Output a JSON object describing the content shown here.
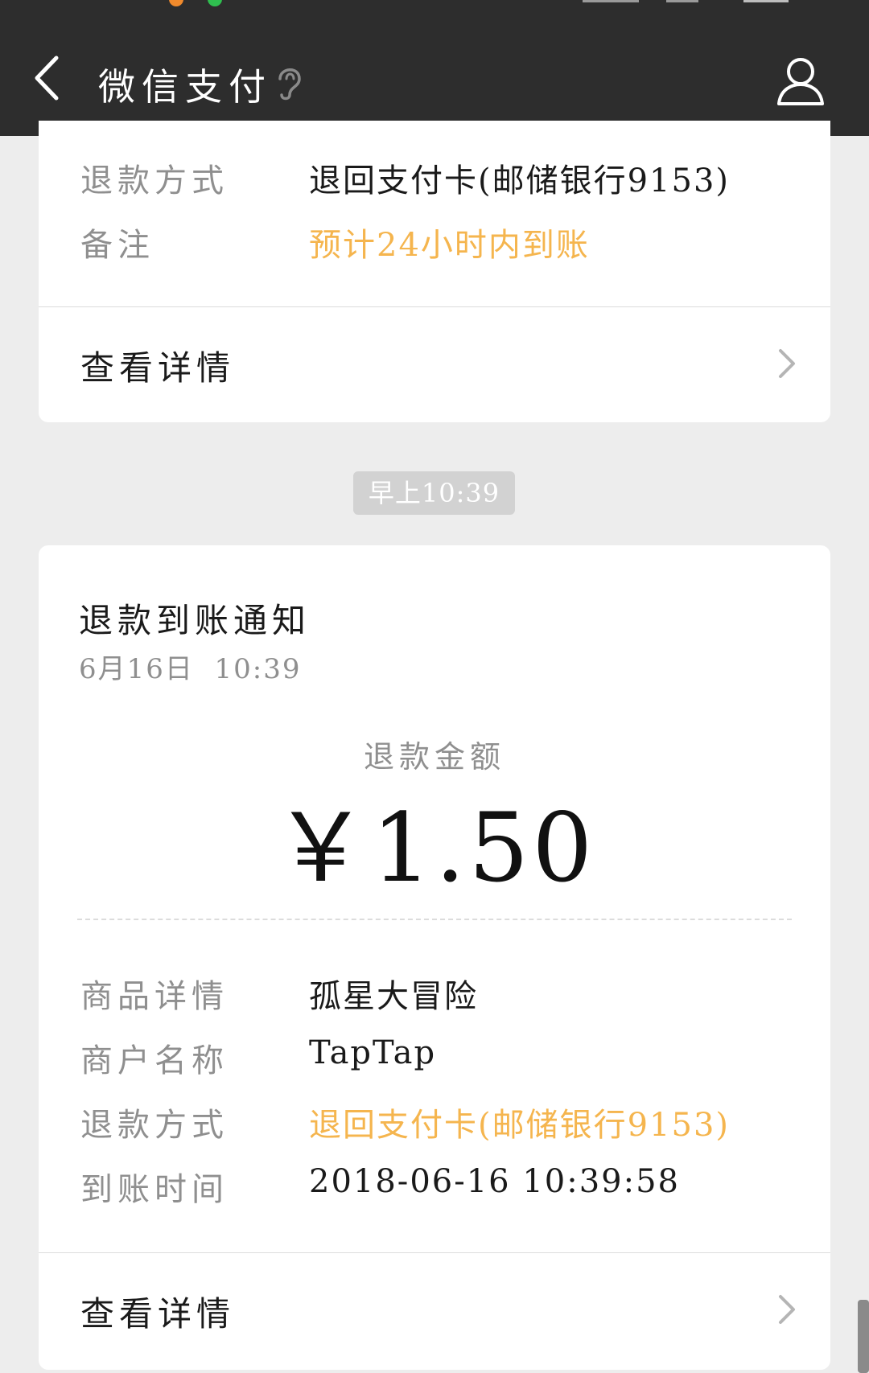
{
  "header": {
    "title": "微信支付"
  },
  "card_top": {
    "rows": [
      {
        "label": "退款方式",
        "value": "退回支付卡(邮储银行9153)"
      },
      {
        "label": "备注",
        "value": "预计24小时内到账"
      }
    ],
    "details_label": "查看详情"
  },
  "time_badge": "早上10:39",
  "notice": {
    "title": "退款到账通知",
    "date": "6月16日  10:39",
    "amount_label": "退款金额",
    "amount": "￥1.50",
    "rows": [
      {
        "label": "商品详情",
        "value": "孤星大冒险"
      },
      {
        "label": "商户名称",
        "value": "TapTap"
      },
      {
        "label": "退款方式",
        "value": "退回支付卡(邮储银行9153)"
      },
      {
        "label": "到账时间",
        "value": "2018-06-16 10:39:58"
      }
    ],
    "details_label": "查看详情"
  },
  "colors": {
    "header_bg": "#2d2d2d",
    "page_bg": "#ededed",
    "highlight": "#f5b54e",
    "label_gray": "#8f8f8f"
  }
}
